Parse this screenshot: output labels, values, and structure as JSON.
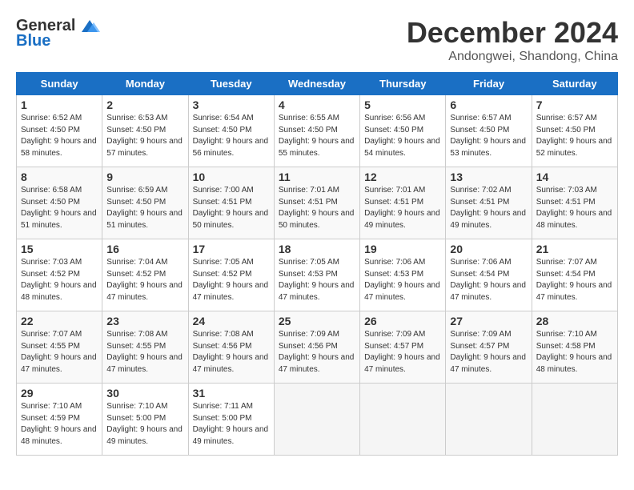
{
  "header": {
    "logo_general": "General",
    "logo_blue": "Blue",
    "month_title": "December 2024",
    "location": "Andongwei, Shandong, China"
  },
  "calendar": {
    "days_of_week": [
      "Sunday",
      "Monday",
      "Tuesday",
      "Wednesday",
      "Thursday",
      "Friday",
      "Saturday"
    ],
    "weeks": [
      [
        {
          "day": "1",
          "sunrise": "6:52 AM",
          "sunset": "4:50 PM",
          "daylight": "9 hours and 58 minutes."
        },
        {
          "day": "2",
          "sunrise": "6:53 AM",
          "sunset": "4:50 PM",
          "daylight": "9 hours and 57 minutes."
        },
        {
          "day": "3",
          "sunrise": "6:54 AM",
          "sunset": "4:50 PM",
          "daylight": "9 hours and 56 minutes."
        },
        {
          "day": "4",
          "sunrise": "6:55 AM",
          "sunset": "4:50 PM",
          "daylight": "9 hours and 55 minutes."
        },
        {
          "day": "5",
          "sunrise": "6:56 AM",
          "sunset": "4:50 PM",
          "daylight": "9 hours and 54 minutes."
        },
        {
          "day": "6",
          "sunrise": "6:57 AM",
          "sunset": "4:50 PM",
          "daylight": "9 hours and 53 minutes."
        },
        {
          "day": "7",
          "sunrise": "6:57 AM",
          "sunset": "4:50 PM",
          "daylight": "9 hours and 52 minutes."
        }
      ],
      [
        {
          "day": "8",
          "sunrise": "6:58 AM",
          "sunset": "4:50 PM",
          "daylight": "9 hours and 51 minutes."
        },
        {
          "day": "9",
          "sunrise": "6:59 AM",
          "sunset": "4:50 PM",
          "daylight": "9 hours and 51 minutes."
        },
        {
          "day": "10",
          "sunrise": "7:00 AM",
          "sunset": "4:51 PM",
          "daylight": "9 hours and 50 minutes."
        },
        {
          "day": "11",
          "sunrise": "7:01 AM",
          "sunset": "4:51 PM",
          "daylight": "9 hours and 50 minutes."
        },
        {
          "day": "12",
          "sunrise": "7:01 AM",
          "sunset": "4:51 PM",
          "daylight": "9 hours and 49 minutes."
        },
        {
          "day": "13",
          "sunrise": "7:02 AM",
          "sunset": "4:51 PM",
          "daylight": "9 hours and 49 minutes."
        },
        {
          "day": "14",
          "sunrise": "7:03 AM",
          "sunset": "4:51 PM",
          "daylight": "9 hours and 48 minutes."
        }
      ],
      [
        {
          "day": "15",
          "sunrise": "7:03 AM",
          "sunset": "4:52 PM",
          "daylight": "9 hours and 48 minutes."
        },
        {
          "day": "16",
          "sunrise": "7:04 AM",
          "sunset": "4:52 PM",
          "daylight": "9 hours and 47 minutes."
        },
        {
          "day": "17",
          "sunrise": "7:05 AM",
          "sunset": "4:52 PM",
          "daylight": "9 hours and 47 minutes."
        },
        {
          "day": "18",
          "sunrise": "7:05 AM",
          "sunset": "4:53 PM",
          "daylight": "9 hours and 47 minutes."
        },
        {
          "day": "19",
          "sunrise": "7:06 AM",
          "sunset": "4:53 PM",
          "daylight": "9 hours and 47 minutes."
        },
        {
          "day": "20",
          "sunrise": "7:06 AM",
          "sunset": "4:54 PM",
          "daylight": "9 hours and 47 minutes."
        },
        {
          "day": "21",
          "sunrise": "7:07 AM",
          "sunset": "4:54 PM",
          "daylight": "9 hours and 47 minutes."
        }
      ],
      [
        {
          "day": "22",
          "sunrise": "7:07 AM",
          "sunset": "4:55 PM",
          "daylight": "9 hours and 47 minutes."
        },
        {
          "day": "23",
          "sunrise": "7:08 AM",
          "sunset": "4:55 PM",
          "daylight": "9 hours and 47 minutes."
        },
        {
          "day": "24",
          "sunrise": "7:08 AM",
          "sunset": "4:56 PM",
          "daylight": "9 hours and 47 minutes."
        },
        {
          "day": "25",
          "sunrise": "7:09 AM",
          "sunset": "4:56 PM",
          "daylight": "9 hours and 47 minutes."
        },
        {
          "day": "26",
          "sunrise": "7:09 AM",
          "sunset": "4:57 PM",
          "daylight": "9 hours and 47 minutes."
        },
        {
          "day": "27",
          "sunrise": "7:09 AM",
          "sunset": "4:57 PM",
          "daylight": "9 hours and 47 minutes."
        },
        {
          "day": "28",
          "sunrise": "7:10 AM",
          "sunset": "4:58 PM",
          "daylight": "9 hours and 48 minutes."
        }
      ],
      [
        {
          "day": "29",
          "sunrise": "7:10 AM",
          "sunset": "4:59 PM",
          "daylight": "9 hours and 48 minutes."
        },
        {
          "day": "30",
          "sunrise": "7:10 AM",
          "sunset": "5:00 PM",
          "daylight": "9 hours and 49 minutes."
        },
        {
          "day": "31",
          "sunrise": "7:11 AM",
          "sunset": "5:00 PM",
          "daylight": "9 hours and 49 minutes."
        },
        null,
        null,
        null,
        null
      ]
    ]
  }
}
